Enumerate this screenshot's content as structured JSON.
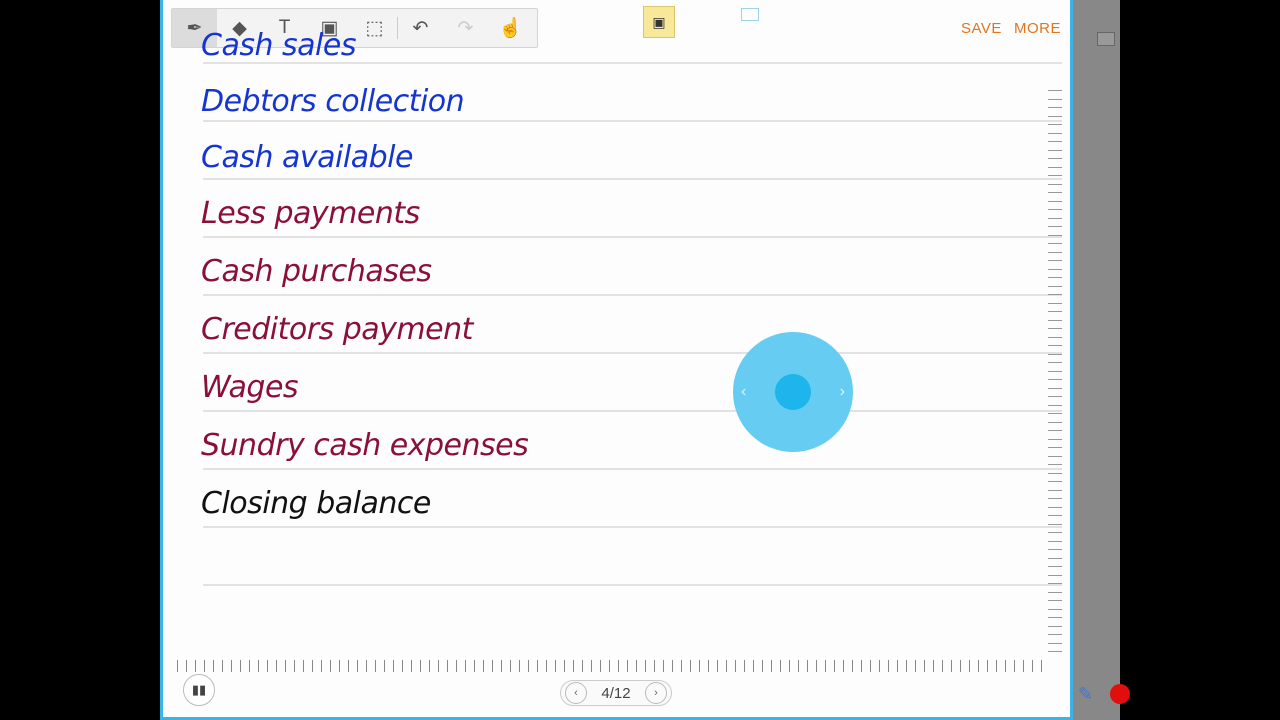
{
  "toolbar": {
    "tools": [
      {
        "name": "pen-tool",
        "icon": "pen-icon",
        "glyph": "✒"
      },
      {
        "name": "eraser-tool",
        "icon": "eraser-icon",
        "glyph": "◆"
      },
      {
        "name": "text-tool",
        "icon": "text-icon",
        "glyph": "T"
      },
      {
        "name": "image-tool",
        "icon": "image-icon",
        "glyph": "▣"
      },
      {
        "name": "selection-tool",
        "icon": "selection-icon",
        "glyph": "⬚"
      },
      {
        "name": "undo-button",
        "icon": "undo-icon",
        "glyph": "↶"
      },
      {
        "name": "redo-button",
        "icon": "redo-icon",
        "glyph": "↷"
      },
      {
        "name": "hand-tool",
        "icon": "hand-icon",
        "glyph": "☝"
      }
    ]
  },
  "header": {
    "save_label": "SAVE",
    "more_label": "MORE",
    "accent": "#e2741d"
  },
  "memo_icon": "memo-icon",
  "notes": {
    "lines": [
      {
        "text": "Cash sales",
        "color": "blue"
      },
      {
        "text": "Debtors collection",
        "color": "blue"
      },
      {
        "text": "Cash available",
        "color": "blue"
      },
      {
        "text": "Less payments",
        "color": "maroon"
      },
      {
        "text": "Cash purchases",
        "color": "maroon"
      },
      {
        "text": "Creditors payment",
        "color": "maroon"
      },
      {
        "text": "Wages",
        "color": "maroon"
      },
      {
        "text": "Sundry cash expenses",
        "color": "maroon"
      },
      {
        "text": "Closing balance",
        "color": "black"
      }
    ],
    "colors": {
      "blue": "#1535d0",
      "maroon": "#8a0f3a",
      "black": "#111111"
    }
  },
  "pager": {
    "label": "4/12",
    "prev_icon": "chevron-left-icon",
    "next_icon": "chevron-right-icon"
  },
  "fab": {
    "prev_glyph": "‹",
    "next_glyph": "›"
  },
  "brush_icon": "brush-icon",
  "accent_border": "#3ab4e6"
}
